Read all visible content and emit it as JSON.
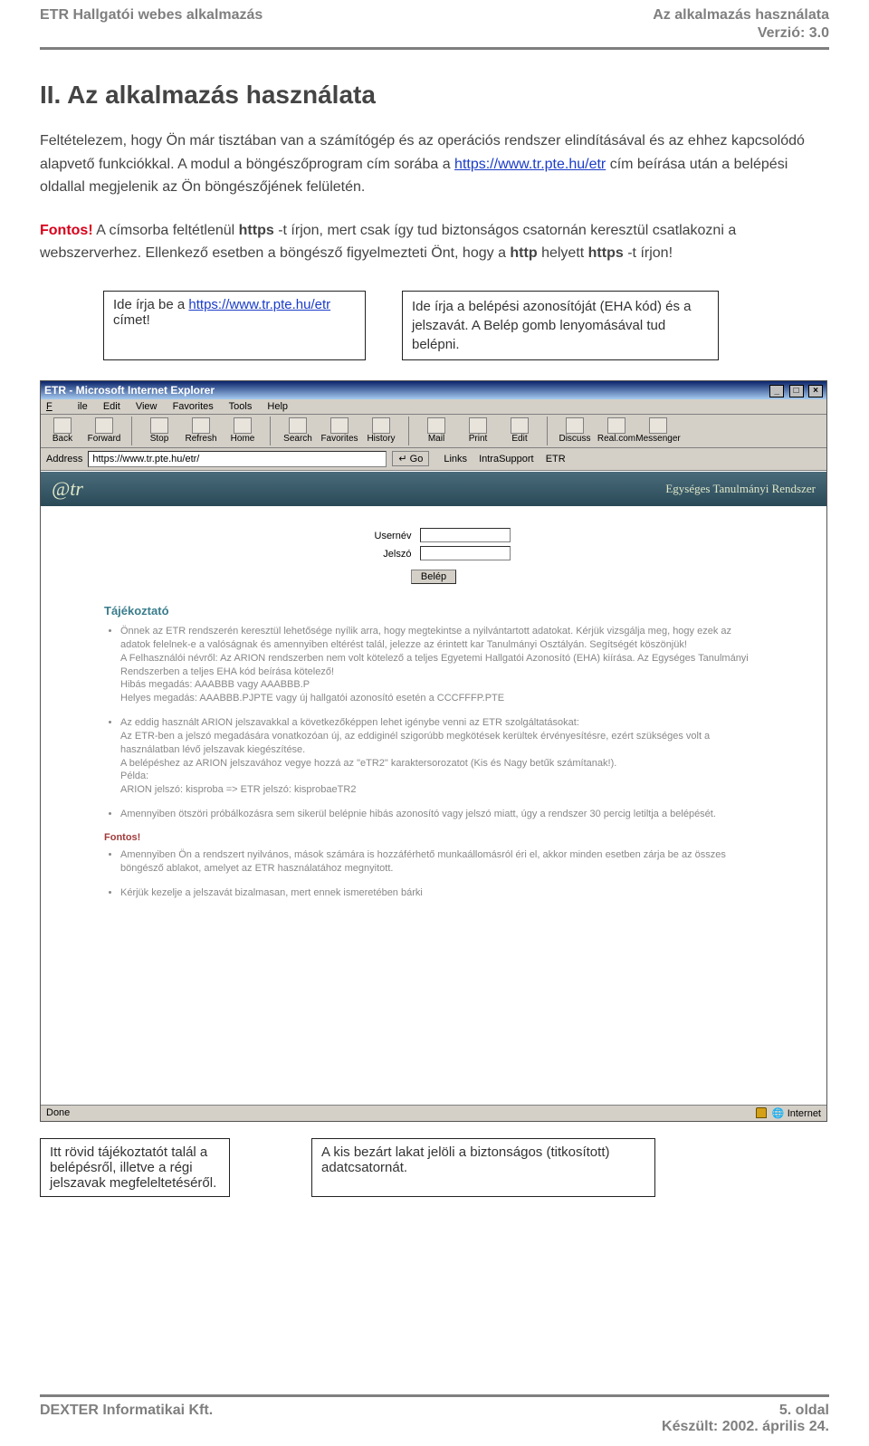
{
  "header": {
    "left": "ETR Hallgatói webes alkalmazás",
    "right": "Az alkalmazás használata",
    "version": "Verzió: 3.0"
  },
  "section_title": "II. Az alkalmazás használata",
  "para1_a": "Feltételezem, hogy Ön már tisztában van a számítógép és az operációs rendszer elindításával és az ehhez kapcsolódó alapvető funkciókkal. A modul a böngészőprogram cím sorába a ",
  "para1_link": "https://www.tr.pte.hu/etr",
  "para1_b": " cím beírása után a belépési oldallal megjelenik az Ön böngészőjének felületén.",
  "fontos_label": "Fontos!",
  "para2_a": " A címsorba feltétlenül ",
  "para2_https": "https",
  "para2_b": "-t írjon, mert csak így tud biztonságos csatornán keresztül csatlakozni a webszerverhez. Ellenkező esetben a böngésző figyelmezteti Önt, hogy a ",
  "para2_http": "http",
  "para2_c": " helyett ",
  "para2_https2": "https",
  "para2_d": "-t írjon!",
  "callout_left_a": "Ide írja be a ",
  "callout_left_link": "https://www.tr.pte.hu/etr",
  "callout_left_b": " címet!",
  "callout_right": "Ide írja a belépési azonosítóját (EHA kód) és a jelszavát. A Belép gomb lenyomásával tud belépni.",
  "ie": {
    "title": "ETR - Microsoft Internet Explorer",
    "menu": [
      "File",
      "Edit",
      "View",
      "Favorites",
      "Tools",
      "Help"
    ],
    "toolbar": [
      "Back",
      "Forward",
      "Stop",
      "Refresh",
      "Home",
      "Search",
      "Favorites",
      "History",
      "Mail",
      "Print",
      "Edit",
      "Discuss",
      "Real.com",
      "Messenger"
    ],
    "addr_label": "Address",
    "addr_value": "https://www.tr.pte.hu/etr/",
    "go": "Go",
    "links_label": "Links",
    "links": [
      "IntraSupport",
      "ETR"
    ],
    "status_done": "Done",
    "status_zone": "Internet"
  },
  "etr": {
    "logo": "@tr",
    "tagline": "Egységes Tanulmányi Rendszer",
    "user_label": "Usernév",
    "pass_label": "Jelszó",
    "login_btn": "Belép",
    "taj_title": "Tájékoztató",
    "b1": "Önnek az ETR rendszerén keresztül lehetősége nyílik arra, hogy megtekintse a nyilvántartott adatokat. Kérjük vizsgálja meg, hogy ezek az adatok felelnek-e a valóságnak és amennyiben eltérést talál, jelezze az érintett kar Tanulmányi Osztályán. Segítségét köszönjük!",
    "b1b": "A Felhasználói névről: Az ARION rendszerben nem volt kötelező a teljes Egyetemi Hallgatói Azonosító (EHA) kiírása. Az Egységes Tanulmányi Rendszerben a teljes EHA kód beírása kötelező!",
    "b1c": "Hibás megadás: AAABBB vagy AAABBB.P",
    "b1d": "Helyes megadás: AAABBB.PJPTE vagy új hallgatói azonosító esetén a CCCFFFP.PTE",
    "b2": "Az eddig használt ARION jelszavakkal a következőképpen lehet igénybe venni az ETR szolgáltatásokat:",
    "b2b": "Az ETR-ben a jelszó megadására vonatkozóan új, az eddiginél szigorúbb megkötések kerültek érvényesítésre, ezért szükséges volt a használatban lévő jelszavak kiegészítése.",
    "b2c": "A belépéshez az ARION jelszavához vegye hozzá az \"eTR2\" karaktersorozatot (Kis és Nagy betűk számítanak!).",
    "b2d": "Példa:",
    "b2e": "ARION jelszó: kisproba => ETR jelszó: kisprobaeTR2",
    "b3": "Amennyiben ötszöri próbálkozásra sem sikerül belépnie hibás azonosító vagy jelszó miatt, úgy a rendszer 30 percig letiltja a belépését.",
    "fontos2": "Fontos!",
    "b4": "Amennyiben Ön a rendszert nyilvános, mások számára is hozzáférhető munkaállomásról éri el, akkor minden esetben zárja be az összes böngésző ablakot, amelyet az ETR használatához megnyitott.",
    "b5": "Kérjük kezelje a jelszavát bizalmasan, mert ennek ismeretében bárki"
  },
  "lower": {
    "c1": "Itt rövid tájékoztatót talál a belépésről, illetve a régi jelszavak megfeleltetéséről.",
    "c2": "A kis bezárt lakat jelöli a biztonságos (titkosított) adatcsatornát."
  },
  "footer": {
    "left": "DEXTER Informatikai Kft.",
    "right_page": "5. oldal",
    "right_date": "Készült: 2002. április 24."
  }
}
